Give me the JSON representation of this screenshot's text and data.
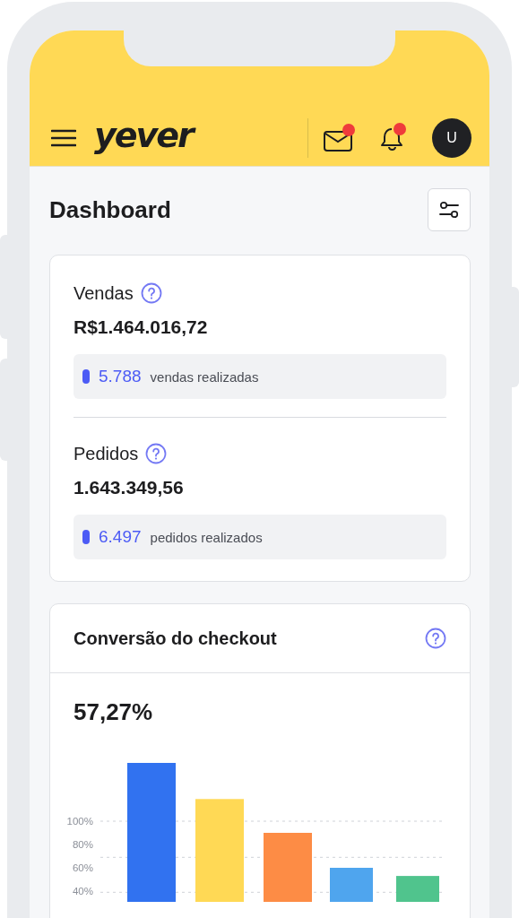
{
  "header": {
    "logo": "yever",
    "mail_unread": true,
    "notifications_unread": true,
    "avatar": "U"
  },
  "page": {
    "title": "Dashboard"
  },
  "summary": [
    {
      "title": "Vendas",
      "value": "R$1.464.016,72",
      "count": "5.788",
      "count_label": "vendas realizadas"
    },
    {
      "title": "Pedidos",
      "value": "1.643.349,56",
      "count": "6.497",
      "count_label": "pedidos realizados"
    }
  ],
  "conversion": {
    "title": "Conversão do checkout",
    "value": "57,27%",
    "axis_labels": [
      "100%",
      "80%",
      "60%",
      "40%"
    ],
    "bars": [
      {
        "color": "#3172f0"
      },
      {
        "color": "#ffd955"
      },
      {
        "color": "#fd8c45"
      },
      {
        "color": "#4fa5ee"
      },
      {
        "color": "#50c48d"
      }
    ]
  }
}
